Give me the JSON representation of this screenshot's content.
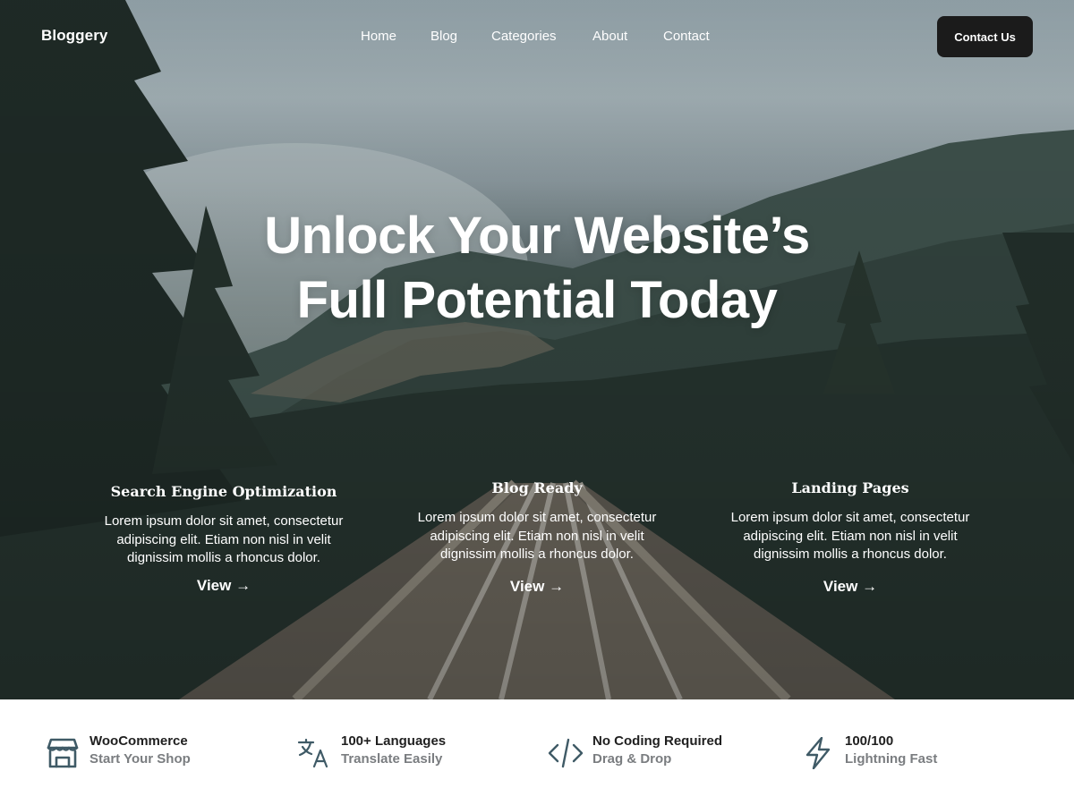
{
  "header": {
    "logo": "Bloggery",
    "nav": [
      "Home",
      "Blog",
      "Categories",
      "About",
      "Contact"
    ],
    "cta": "Contact Us"
  },
  "hero": {
    "title_line1": "Unlock Your Website’s",
    "title_line2": "Full Potential Today"
  },
  "features": [
    {
      "title": "Search Engine Optimization",
      "text": "Lorem ipsum dolor sit amet, consectetur adipiscing elit. Etiam non nisl in velit dignissim mollis a rhoncus dolor.",
      "link": "View →"
    },
    {
      "title": "Blog Ready",
      "text": "Lorem ipsum dolor sit amet, consectetur adipiscing elit. Etiam non nisl in velit dignissim mollis a rhoncus dolor.",
      "link": "View →"
    },
    {
      "title": "Landing Pages",
      "text": "Lorem ipsum dolor sit amet, consectetur adipiscing elit. Etiam non nisl in velit dignissim mollis a rhoncus dolor.",
      "link": "View →"
    }
  ],
  "highlights": [
    {
      "icon": "store-icon",
      "title": "WooCommerce",
      "subtitle": "Start Your Shop"
    },
    {
      "icon": "translate-icon",
      "title": "100+ Languages",
      "subtitle": "Translate Easily"
    },
    {
      "icon": "code-icon",
      "title": "No Coding Required",
      "subtitle": "Drag & Drop"
    },
    {
      "icon": "lightning-icon",
      "title": "100/100",
      "subtitle": "Lightning Fast"
    }
  ],
  "colors": {
    "cta_background": "#1b1b1b",
    "icon_color": "#3f5a66",
    "subtitle_gray": "#7a7d80"
  }
}
